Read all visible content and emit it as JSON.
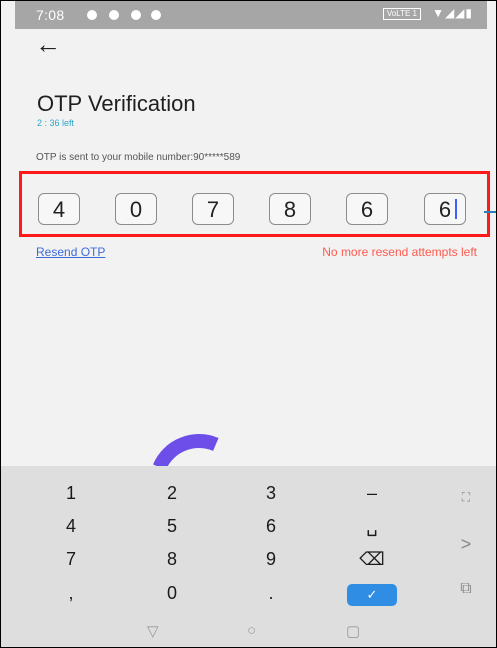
{
  "status": {
    "time": "7:08",
    "network": "VoLTE 1",
    "icons": "▼◢◢▮"
  },
  "back_icon": "←",
  "title": "OTP Verification",
  "timer": "2 : 36 left",
  "sent_text": "OTP is sent to your mobile number:90*****589",
  "otp_digits": [
    "4",
    "0",
    "7",
    "8",
    "6",
    "6"
  ],
  "resend_label": "Resend OTP",
  "resend_status": "No more resend attempts left",
  "keypad": {
    "row1": [
      "1",
      "2",
      "3",
      "–"
    ],
    "row2": [
      "4",
      "5",
      "6",
      "␣"
    ],
    "row3": [
      "7",
      "8",
      "9",
      "⌫"
    ],
    "row4": [
      ",",
      "0",
      ".",
      "✓"
    ],
    "side": [
      "⛶",
      ">",
      "⧉"
    ]
  },
  "nav": [
    "▽",
    "○",
    "▢"
  ]
}
